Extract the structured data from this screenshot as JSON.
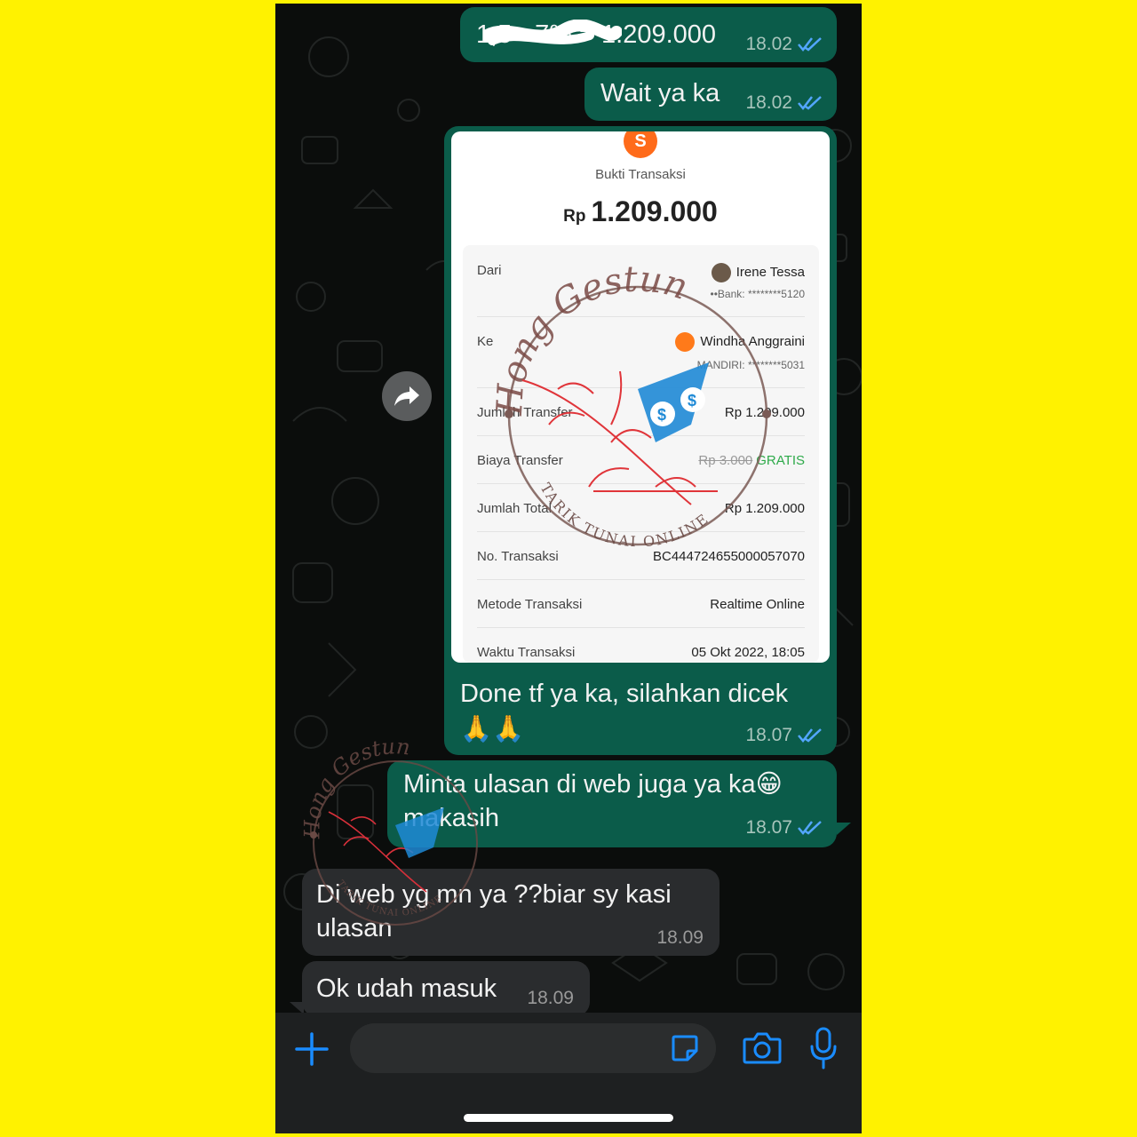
{
  "chat": {
    "messages": [
      {
        "id": "m1",
        "dir": "out",
        "text": "1,5 - 7% = 1.209.000",
        "time": "18.02"
      },
      {
        "id": "m2",
        "dir": "out",
        "text": "Wait ya ka",
        "time": "18.02"
      },
      {
        "id": "m3",
        "dir": "out",
        "caption_line1": "Done tf ya ka, silahkan dicek",
        "caption_line2": "🙏🙏",
        "time": "18.07"
      },
      {
        "id": "m4",
        "dir": "out",
        "line1": "Minta ulasan di web juga ya ka😁",
        "line2": "makasih",
        "time": "18.07"
      },
      {
        "id": "m5",
        "dir": "in",
        "line1": "Di web yg mn ya ??biar sy kasi",
        "line2": "ulasan",
        "time": "18.09"
      },
      {
        "id": "m6",
        "dir": "in",
        "text": "Ok udah masuk",
        "time": "18.09"
      }
    ]
  },
  "receipt": {
    "logo_letter": "S",
    "title": "Bukti Transaksi",
    "currency": "Rp",
    "amount": "1.209.000",
    "from_label": "Dari",
    "from_name": "Irene Tessa",
    "from_account": "••Bank: ********5120",
    "to_label": "Ke",
    "to_name": "Windha Anggraini",
    "to_account": "MANDIRI: ********5031",
    "transfer_amount_label": "Jumlah Transfer",
    "transfer_amount": "Rp 1.209.000",
    "fee_label": "Biaya Transfer",
    "fee_original": "Rp 3.000",
    "fee_value": "GRATIS",
    "total_label": "Jumlah Total",
    "total": "Rp 1.209.000",
    "trx_no_label": "No. Transaksi",
    "trx_no": "BC444724655000057070",
    "method_label": "Metode Transaksi",
    "method": "Realtime Online",
    "time_label": "Waktu Transaksi",
    "time": "05 Okt 2022, 18:05"
  },
  "watermark": {
    "brand": "Hong Gestun",
    "tagline": "TARIK TUNAI ONLINE"
  },
  "colors": {
    "background": "#fff200",
    "outgoing_bubble": "#0b5c4a",
    "incoming_bubble": "#2a2c2e",
    "accent_blue": "#1a8cff",
    "read_ticks": "#53a6ff"
  },
  "icons": {
    "forward": "forward-arrow-icon",
    "attach": "plus-icon",
    "sticker": "sticker-icon",
    "camera": "camera-icon",
    "mic": "microphone-icon"
  }
}
